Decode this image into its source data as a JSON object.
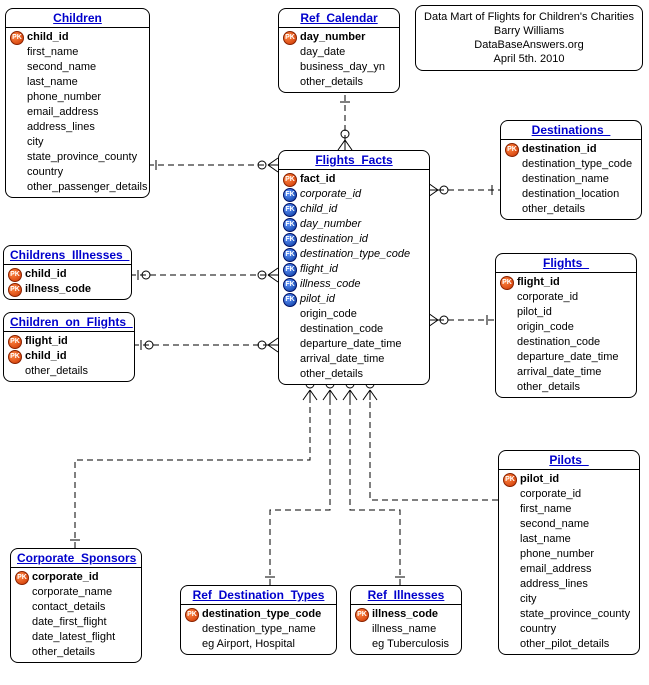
{
  "info_box": {
    "line1": "Data Mart of Flights for Children's Charities",
    "line2": "Barry Williams",
    "line3": "DataBaseAnswers.org",
    "line4": "April 5th. 2010"
  },
  "entities": {
    "children": {
      "title": "Children",
      "attrs": [
        {
          "key": "pk",
          "name": "child_id",
          "bold": true
        },
        {
          "name": "first_name"
        },
        {
          "name": "second_name"
        },
        {
          "name": "last_name"
        },
        {
          "name": "phone_number"
        },
        {
          "name": "email_address"
        },
        {
          "name": "address_lines"
        },
        {
          "name": "city"
        },
        {
          "name": "state_province_county"
        },
        {
          "name": "country"
        },
        {
          "name": "other_passenger_details"
        }
      ]
    },
    "ref_calendar": {
      "title": "Ref_Calendar",
      "attrs": [
        {
          "key": "pk",
          "name": "day_number",
          "bold": true
        },
        {
          "name": "day_date"
        },
        {
          "name": "business_day_yn"
        },
        {
          "name": "other_details"
        }
      ]
    },
    "destinations": {
      "title": "Destinations_",
      "attrs": [
        {
          "key": "pk",
          "name": "destination_id",
          "bold": true
        },
        {
          "name": "destination_type_code"
        },
        {
          "name": "destination_name"
        },
        {
          "name": "destination_location"
        },
        {
          "name": "other_details"
        }
      ]
    },
    "childrens_illnesses": {
      "title": "Childrens_Illnesses_",
      "attrs": [
        {
          "key": "pk",
          "name": "child_id",
          "bold": true
        },
        {
          "key": "pk",
          "name": "illness_code",
          "bold": true
        }
      ]
    },
    "children_on_flights": {
      "title": "Children_on_Flights_",
      "attrs": [
        {
          "key": "pk",
          "name": "flight_id",
          "bold": true
        },
        {
          "key": "pk",
          "name": "child_id",
          "bold": true
        },
        {
          "name": "other_details"
        }
      ]
    },
    "flights_facts": {
      "title": "Flights_Facts",
      "attrs": [
        {
          "key": "pk",
          "name": "fact_id",
          "bold": true
        },
        {
          "key": "fk",
          "name": "corporate_id",
          "italic": true
        },
        {
          "key": "fk",
          "name": "child_id",
          "italic": true
        },
        {
          "key": "fk",
          "name": "day_number",
          "italic": true
        },
        {
          "key": "fk",
          "name": "destination_id",
          "italic": true
        },
        {
          "key": "fk",
          "name": "destination_type_code",
          "italic": true
        },
        {
          "key": "fk",
          "name": "flight_id",
          "italic": true
        },
        {
          "key": "fk",
          "name": "illness_code",
          "italic": true
        },
        {
          "key": "fk",
          "name": "pilot_id",
          "italic": true
        },
        {
          "name": "origin_code"
        },
        {
          "name": "destination_code"
        },
        {
          "name": "departure_date_time"
        },
        {
          "name": "arrival_date_time"
        },
        {
          "name": "other_details"
        }
      ]
    },
    "flights": {
      "title": "Flights_",
      "attrs": [
        {
          "key": "pk",
          "name": "flight_id",
          "bold": true
        },
        {
          "name": "corporate_id"
        },
        {
          "name": "pilot_id"
        },
        {
          "name": "origin_code"
        },
        {
          "name": "destination_code"
        },
        {
          "name": "departure_date_time"
        },
        {
          "name": "arrival_date_time"
        },
        {
          "name": "other_details"
        }
      ]
    },
    "corporate_sponsors": {
      "title": "Corporate_Sponsors",
      "attrs": [
        {
          "key": "pk",
          "name": "corporate_id",
          "bold": true
        },
        {
          "name": "corporate_name"
        },
        {
          "name": "contact_details"
        },
        {
          "name": "date_first_flight"
        },
        {
          "name": "date_latest_flight"
        },
        {
          "name": "other_details"
        }
      ]
    },
    "ref_destination_types": {
      "title": "Ref_Destination_Types",
      "attrs": [
        {
          "key": "pk",
          "name": "destination_type_code",
          "bold": true
        },
        {
          "name": "destination_type_name"
        },
        {
          "name": "eg Airport, Hospital"
        }
      ]
    },
    "ref_illnesses": {
      "title": "Ref_Illnesses",
      "attrs": [
        {
          "key": "pk",
          "name": "illness_code",
          "bold": true
        },
        {
          "name": "illness_name"
        },
        {
          "name": "eg Tuberculosis"
        }
      ]
    },
    "pilots": {
      "title": "Pilots_",
      "attrs": [
        {
          "key": "pk",
          "name": "pilot_id",
          "bold": true
        },
        {
          "name": "corporate_id"
        },
        {
          "name": "first_name"
        },
        {
          "name": "second_name"
        },
        {
          "name": "last_name"
        },
        {
          "name": "phone_number"
        },
        {
          "name": "email_address"
        },
        {
          "name": "address_lines"
        },
        {
          "name": "city"
        },
        {
          "name": "state_province_county"
        },
        {
          "name": "country"
        },
        {
          "name": "other_pilot_details"
        }
      ]
    }
  }
}
